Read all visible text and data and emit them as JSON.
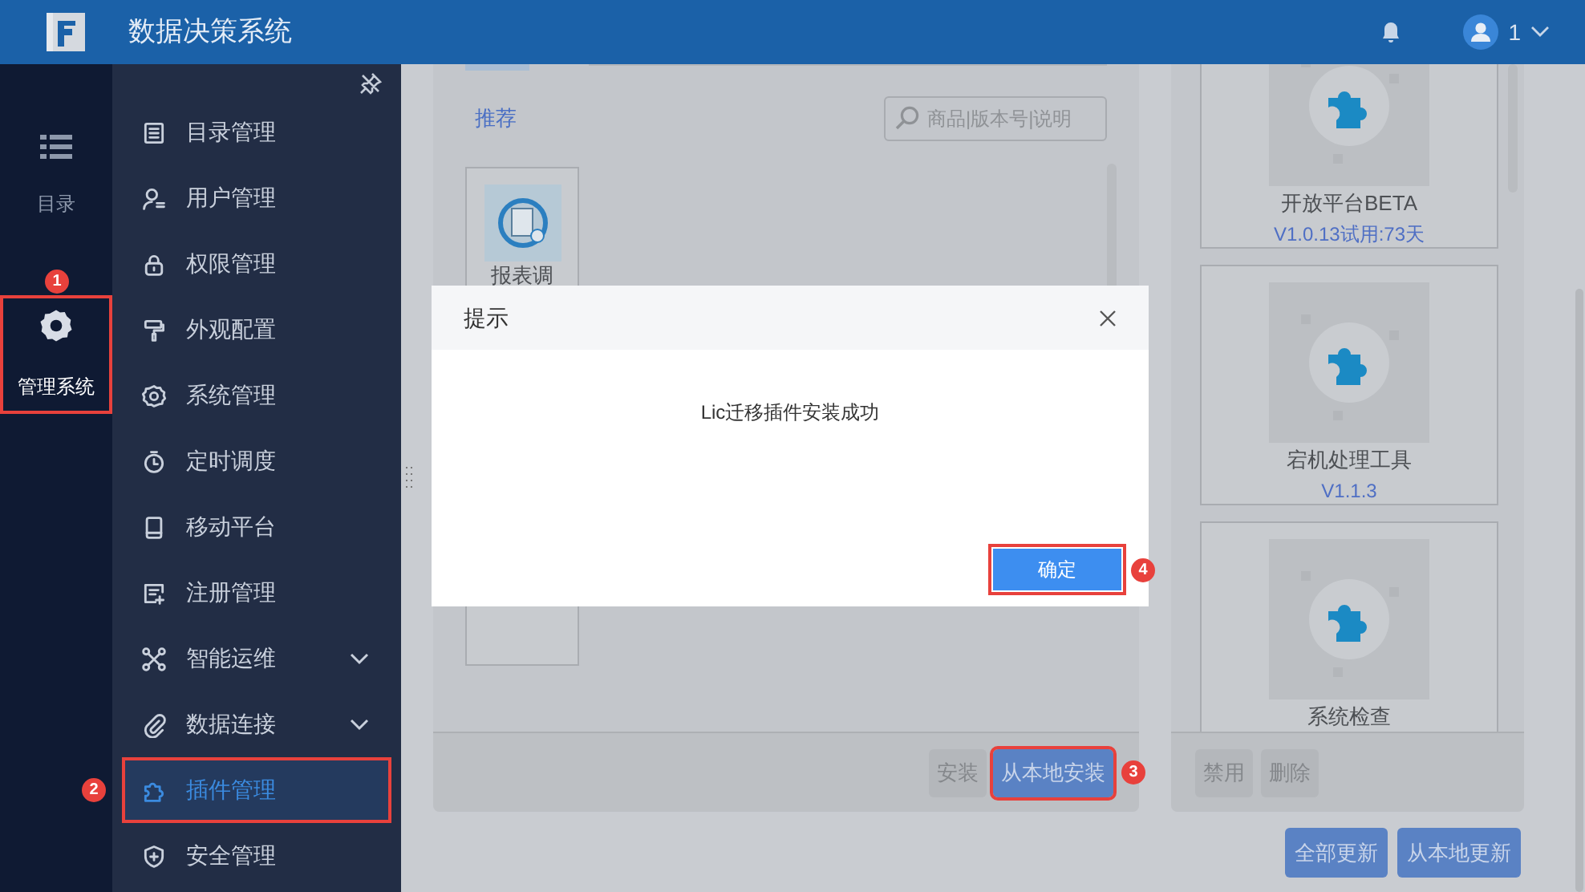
{
  "header": {
    "title": "数据决策系统",
    "user": "1"
  },
  "rail": [
    {
      "kind": "list",
      "label": "目录",
      "selected": false
    },
    {
      "kind": "gear",
      "label": "管理系统",
      "selected": true,
      "callout": "1"
    }
  ],
  "sidebar": {
    "items": [
      {
        "kind": "catalog",
        "label": "目录管理",
        "selected": false,
        "expandable": false
      },
      {
        "kind": "user",
        "label": "用户管理",
        "selected": false,
        "expandable": false
      },
      {
        "kind": "lock",
        "label": "权限管理",
        "selected": false,
        "expandable": false
      },
      {
        "kind": "brush",
        "label": "外观配置",
        "selected": false,
        "expandable": false
      },
      {
        "kind": "gear",
        "label": "系统管理",
        "selected": false,
        "expandable": false
      },
      {
        "kind": "timer",
        "label": "定时调度",
        "selected": false,
        "expandable": false
      },
      {
        "kind": "mobile",
        "label": "移动平台",
        "selected": false,
        "expandable": false
      },
      {
        "kind": "register",
        "label": "注册管理",
        "selected": false,
        "expandable": false
      },
      {
        "kind": "network",
        "label": "智能运维",
        "selected": false,
        "expandable": true
      },
      {
        "kind": "link",
        "label": "数据连接",
        "selected": false,
        "expandable": true
      },
      {
        "kind": "puzzle",
        "label": "插件管理",
        "selected": true,
        "expandable": false,
        "callout": "2"
      },
      {
        "kind": "shield",
        "label": "安全管理",
        "selected": false,
        "expandable": false
      }
    ]
  },
  "store": {
    "tab": "推荐",
    "search": {
      "placeholder": "商品|版本号|说明"
    },
    "plugins": [
      {
        "name": "报表调"
      }
    ],
    "buttons": [
      {
        "label": "安装",
        "kind": "plain"
      },
      {
        "label": "从本地安装",
        "kind": "primary",
        "callout": "3"
      }
    ]
  },
  "installed": {
    "plugins": [
      {
        "name": "开放平台BETA",
        "version": "V1.0.13试用:73天"
      },
      {
        "name": "宕机处理工具",
        "version": "V1.1.3"
      },
      {
        "name": "系统检查"
      }
    ],
    "buttons": [
      {
        "label": "禁用",
        "kind": "plain"
      },
      {
        "label": "删除",
        "kind": "plain"
      }
    ],
    "footer_buttons": [
      {
        "label": "全部更新",
        "kind": "primary"
      },
      {
        "label": "从本地更新",
        "kind": "primary"
      }
    ]
  },
  "dialog": {
    "title": "提示",
    "message": "Lic迁移插件安装成功",
    "button": {
      "label": "确定",
      "callout": "4"
    }
  }
}
